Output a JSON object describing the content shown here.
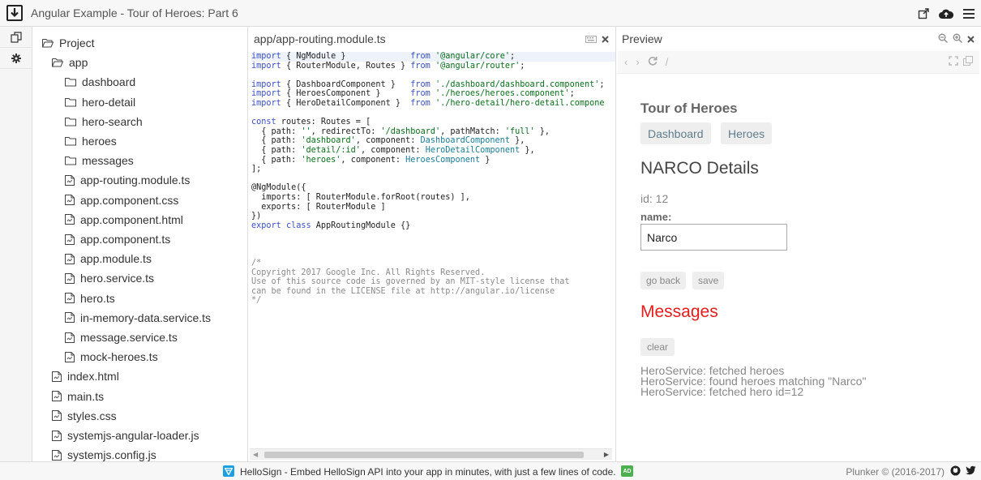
{
  "app": {
    "title": "Angular Example - Tour of Heroes: Part 6"
  },
  "icons": {
    "download": "download-icon",
    "external": "external-link-icon",
    "cloud": "cloud-upload-icon",
    "menu": "hamburger-menu-icon",
    "files": "files-icon",
    "settings": "gear-icon"
  },
  "tree": {
    "items": [
      {
        "label": "Project",
        "type": "folder-open"
      },
      {
        "label": "app",
        "type": "folder-open"
      },
      {
        "label": "dashboard",
        "type": "folder"
      },
      {
        "label": "hero-detail",
        "type": "folder"
      },
      {
        "label": "hero-search",
        "type": "folder"
      },
      {
        "label": "heroes",
        "type": "folder"
      },
      {
        "label": "messages",
        "type": "folder"
      },
      {
        "label": "app-routing.module.ts",
        "type": "file"
      },
      {
        "label": "app.component.css",
        "type": "file"
      },
      {
        "label": "app.component.html",
        "type": "file"
      },
      {
        "label": "app.component.ts",
        "type": "file"
      },
      {
        "label": "app.module.ts",
        "type": "file"
      },
      {
        "label": "hero.service.ts",
        "type": "file"
      },
      {
        "label": "hero.ts",
        "type": "file"
      },
      {
        "label": "in-memory-data.service.ts",
        "type": "file"
      },
      {
        "label": "message.service.ts",
        "type": "file"
      },
      {
        "label": "mock-heroes.ts",
        "type": "file"
      },
      {
        "label": "index.html",
        "type": "file"
      },
      {
        "label": "main.ts",
        "type": "file"
      },
      {
        "label": "styles.css",
        "type": "file"
      },
      {
        "label": "systemjs-angular-loader.js",
        "type": "file"
      },
      {
        "label": "systemjs.config.js",
        "type": "file"
      }
    ]
  },
  "editor": {
    "filename": "app/app-routing.module.ts",
    "lines": [
      [
        [
          "kw",
          "import"
        ],
        [
          "plain",
          " { NgModule }             "
        ],
        [
          "kw",
          "from"
        ],
        [
          "plain",
          " "
        ],
        [
          "str",
          "'@angular/core'"
        ],
        [
          "plain",
          ";"
        ]
      ],
      [
        [
          "kw",
          "import"
        ],
        [
          "plain",
          " { RouterModule, Routes } "
        ],
        [
          "kw",
          "from"
        ],
        [
          "plain",
          " "
        ],
        [
          "str",
          "'@angular/router'"
        ],
        [
          "plain",
          ";"
        ]
      ],
      [],
      [
        [
          "kw",
          "import"
        ],
        [
          "plain",
          " { DashboardComponent }   "
        ],
        [
          "kw",
          "from"
        ],
        [
          "plain",
          " "
        ],
        [
          "str",
          "'./dashboard/dashboard.component'"
        ],
        [
          "plain",
          ";"
        ]
      ],
      [
        [
          "kw",
          "import"
        ],
        [
          "plain",
          " { HeroesComponent }      "
        ],
        [
          "kw",
          "from"
        ],
        [
          "plain",
          " "
        ],
        [
          "str",
          "'./heroes/heroes.component'"
        ],
        [
          "plain",
          ";"
        ]
      ],
      [
        [
          "kw",
          "import"
        ],
        [
          "plain",
          " { HeroDetailComponent }  "
        ],
        [
          "kw",
          "from"
        ],
        [
          "plain",
          " "
        ],
        [
          "str",
          "'./hero-detail/hero-detail.compone"
        ]
      ],
      [],
      [
        [
          "kw",
          "const"
        ],
        [
          "plain",
          " routes: Routes = ["
        ]
      ],
      [
        [
          "plain",
          "  { path: "
        ],
        [
          "str",
          "''"
        ],
        [
          "plain",
          ", redirectTo: "
        ],
        [
          "str",
          "'/dashboard'"
        ],
        [
          "plain",
          ", pathMatch: "
        ],
        [
          "str",
          "'full'"
        ],
        [
          "plain",
          " },"
        ]
      ],
      [
        [
          "plain",
          "  { path: "
        ],
        [
          "str",
          "'dashboard'"
        ],
        [
          "plain",
          ", component: "
        ],
        [
          "ty",
          "DashboardComponent"
        ],
        [
          "plain",
          " },"
        ]
      ],
      [
        [
          "plain",
          "  { path: "
        ],
        [
          "str",
          "'detail/:id'"
        ],
        [
          "plain",
          ", component: "
        ],
        [
          "ty",
          "HeroDetailComponent"
        ],
        [
          "plain",
          " },"
        ]
      ],
      [
        [
          "plain",
          "  { path: "
        ],
        [
          "str",
          "'heroes'"
        ],
        [
          "plain",
          ", component: "
        ],
        [
          "ty",
          "HeroesComponent"
        ],
        [
          "plain",
          " }"
        ]
      ],
      [
        [
          "plain",
          "];"
        ]
      ],
      [],
      [
        [
          "plain",
          "@NgModule({"
        ]
      ],
      [
        [
          "plain",
          "  imports: [ RouterModule.forRoot(routes) ],"
        ]
      ],
      [
        [
          "plain",
          "  exports: [ RouterModule ]"
        ]
      ],
      [
        [
          "plain",
          "})"
        ]
      ],
      [
        [
          "kw",
          "export"
        ],
        [
          "plain",
          " "
        ],
        [
          "kw",
          "class"
        ],
        [
          "plain",
          " AppRoutingModule {}"
        ]
      ],
      [],
      [],
      [],
      [
        [
          "cm",
          "/*"
        ]
      ],
      [
        [
          "cm",
          "Copyright 2017 Google Inc. All Rights Reserved."
        ]
      ],
      [
        [
          "cm",
          "Use of this source code is governed by an MIT-style license that"
        ]
      ],
      [
        [
          "cm",
          "can be found in the LICENSE file at http://angular.io/license"
        ]
      ],
      [
        [
          "cm",
          "*/"
        ]
      ]
    ]
  },
  "preview": {
    "header": "Preview",
    "url": "/",
    "app_title": "Tour of Heroes",
    "nav": [
      "Dashboard",
      "Heroes"
    ],
    "details_title": "NARCO Details",
    "id_text": "id: 12",
    "name_label": "name:",
    "name_value": "Narco",
    "go_back_label": "go back",
    "save_label": "save",
    "messages_title": "Messages",
    "clear_label": "clear",
    "messages": [
      "HeroService: fetched heroes",
      "HeroService: found heroes matching \"Narco\"",
      "HeroService: fetched hero id=12"
    ],
    "colors": {
      "messages_title": "#e51d1d",
      "nav_text": "#607d8b"
    }
  },
  "footer": {
    "ad_icon": "hellosign-logo",
    "ad_text": "HelloSign - Embed HelloSign API into your app in minutes, with just a few lines of code.",
    "ad_badge": "AD",
    "credits": "Plunker © (2016-2017)",
    "github_icon": "github-icon",
    "twitter_icon": "twitter-icon"
  }
}
